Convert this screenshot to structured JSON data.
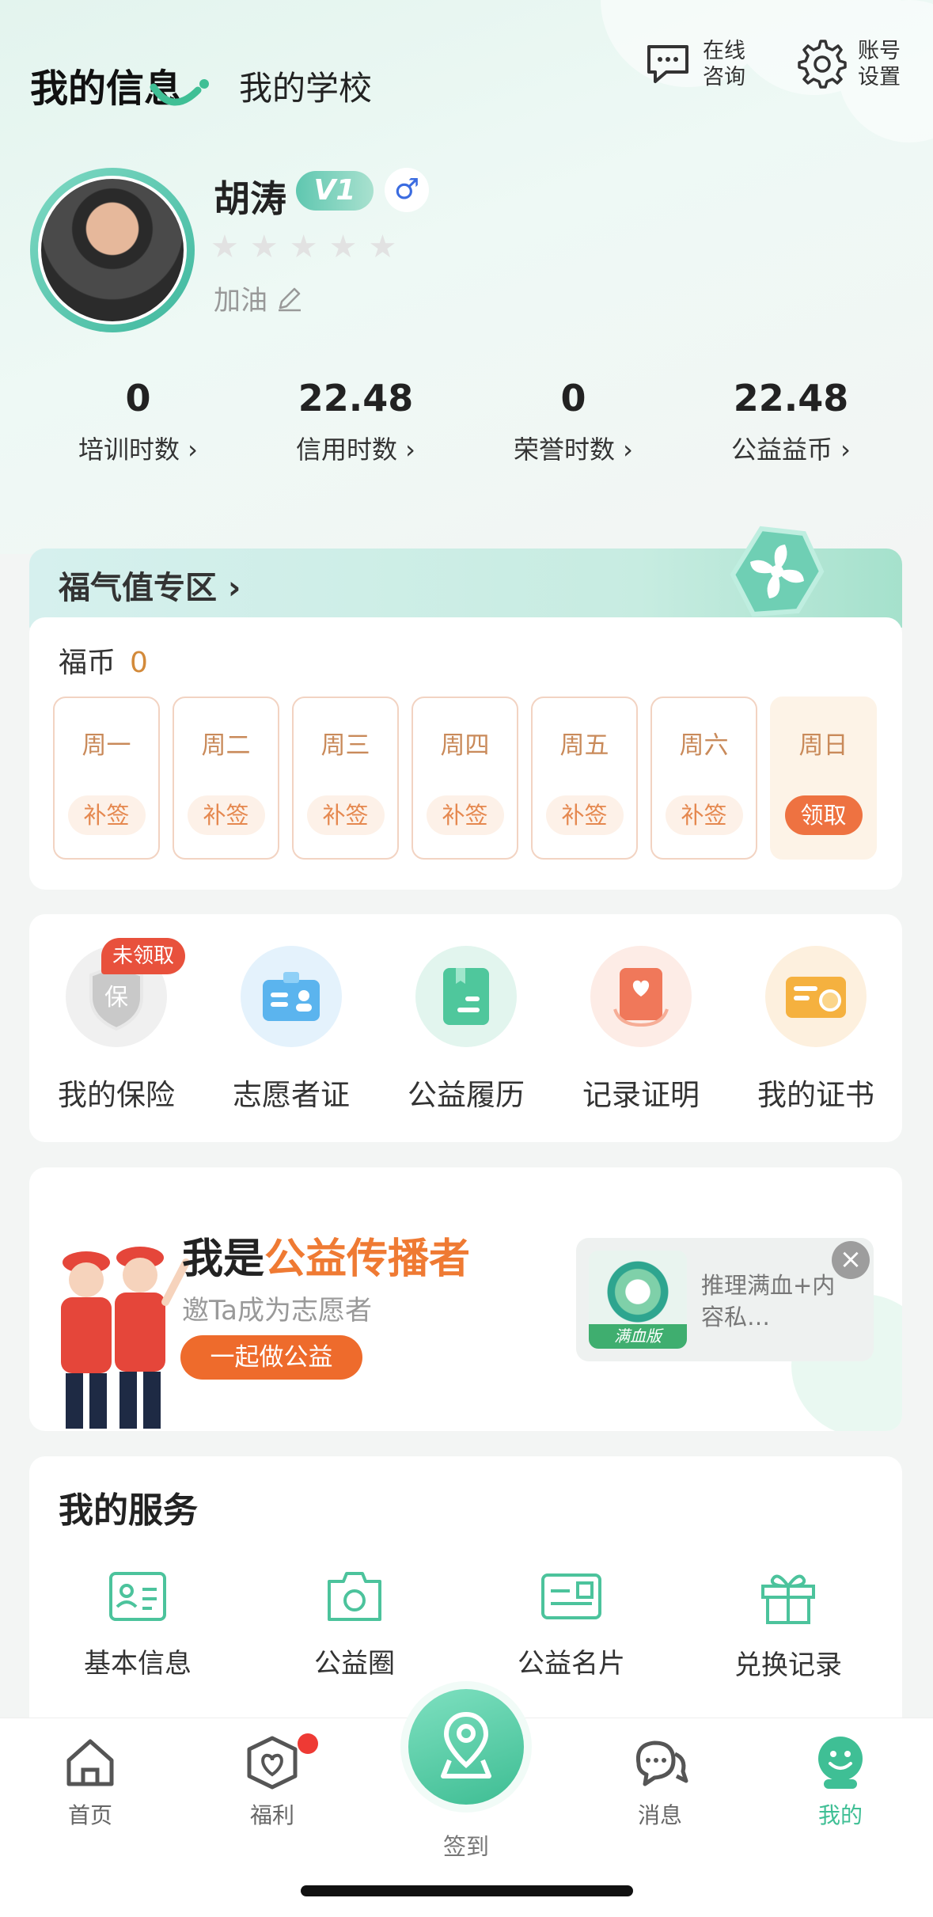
{
  "header": {
    "tabs": [
      "我的信息",
      "我的学校"
    ],
    "consult_label": "在线咨询",
    "settings_label": "账号设置"
  },
  "profile": {
    "name": "胡涛",
    "level": "V1",
    "gender_symbol": "♂",
    "stars_total": 5,
    "stars_filled": 0,
    "motto": "加油"
  },
  "stats": [
    {
      "value": "0",
      "label": "培训时数 ›"
    },
    {
      "value": "22.48",
      "label": "信用时数 ›"
    },
    {
      "value": "0",
      "label": "荣誉时数 ›"
    },
    {
      "value": "22.48",
      "label": "公益益币 ›"
    }
  ],
  "fortune": {
    "title": "福气值专区 ›",
    "coin_label": "福币",
    "coin_value": "0",
    "days": [
      {
        "day": "周一",
        "action": "补签"
      },
      {
        "day": "周二",
        "action": "补签"
      },
      {
        "day": "周三",
        "action": "补签"
      },
      {
        "day": "周四",
        "action": "补签"
      },
      {
        "day": "周五",
        "action": "补签"
      },
      {
        "day": "周六",
        "action": "补签"
      },
      {
        "day": "周日",
        "action": "领取"
      }
    ]
  },
  "tools": {
    "unclaimed_badge": "未领取",
    "insurance_glyph": "保",
    "items": [
      "我的保险",
      "志愿者证",
      "公益履历",
      "记录证明",
      "我的证书"
    ]
  },
  "banner": {
    "title_prefix": "我是",
    "title_highlight": "公益传播者",
    "subtitle": "邀Ta成为志愿者",
    "button": "一起做公益",
    "ad_tag": "满血版",
    "ad_text": "推理满血+内容私…"
  },
  "services": {
    "title": "我的服务",
    "items": [
      "基本信息",
      "公益圈",
      "公益名片",
      "兑换记录"
    ]
  },
  "tabbar": {
    "items": [
      "首页",
      "福利",
      "签到",
      "消息",
      "我的"
    ],
    "active": "我的"
  },
  "colors": {
    "accent": "#3fbf95",
    "orange": "#ee7241",
    "badge_red": "#e8513c"
  }
}
